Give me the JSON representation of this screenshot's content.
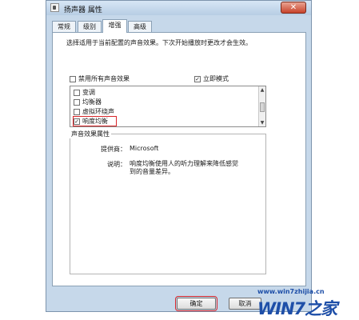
{
  "window": {
    "title": "扬声器 属性",
    "close_glyph": "✕"
  },
  "tabs": [
    {
      "label": "常规"
    },
    {
      "label": "级别"
    },
    {
      "label": "增强"
    },
    {
      "label": "高级"
    }
  ],
  "description": "选择适用于当前配置的声音效果。下次开始播放时更改才会生效。",
  "options": {
    "disable_all": {
      "label": "禁用所有声音效果",
      "checked": false
    },
    "immediate_mode": {
      "label": "立即模式",
      "checked": true
    }
  },
  "effects": [
    {
      "label": "变调",
      "checked": false
    },
    {
      "label": "均衡器",
      "checked": false
    },
    {
      "label": "虚拟环绕声",
      "checked": false
    },
    {
      "label": "响度均衡",
      "checked": true
    }
  ],
  "properties": {
    "legend": "声音效果属性",
    "provider_label": "提供商：",
    "provider_value": "Microsoft",
    "desc_label": "说明：",
    "desc_value": "响度均衡使用人的听力理解来降低感觉到的音量差异。"
  },
  "buttons": {
    "ok": "确定",
    "cancel": "取消"
  },
  "watermark": {
    "url": "www.win7zhijia.cn",
    "logo": "WIN7之家"
  },
  "check_glyph": "✓"
}
